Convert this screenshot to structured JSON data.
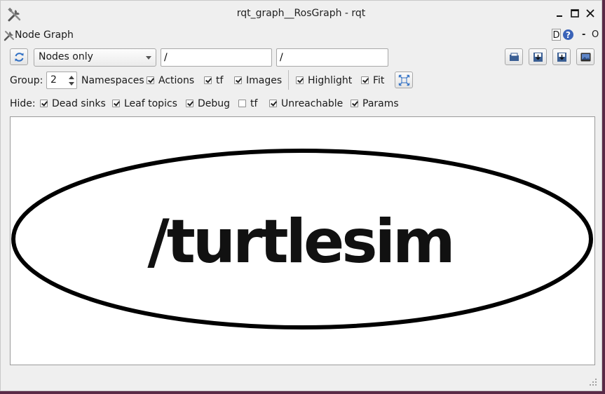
{
  "window": {
    "title": "rqt_graph__RosGraph - rqt",
    "minimize_icon": "minimize-icon",
    "maximize_icon": "maximize-icon",
    "close_icon": "close-icon"
  },
  "plugin": {
    "title": "Node Graph",
    "d_label": "D",
    "help_icon": "help-icon",
    "dash_label": "-",
    "o_label": "O"
  },
  "toolbar": {
    "refresh_icon": "refresh-icon",
    "graph_type": "Nodes only",
    "node_filter": "/",
    "topic_filter": "/",
    "right_icons": [
      "load-dot-icon",
      "save-dot-icon",
      "save-svg-icon",
      "save-image-icon"
    ]
  },
  "options": {
    "group_label": "Group:",
    "group_value": "2",
    "namespaces_label": "Namespaces",
    "checks": [
      {
        "label": "Actions",
        "checked": true
      },
      {
        "label": "tf",
        "checked": true
      },
      {
        "label": "Images",
        "checked": true
      },
      {
        "label": "Highlight",
        "checked": true
      },
      {
        "label": "Fit",
        "checked": true
      }
    ],
    "fit_icon": "fit-view-icon"
  },
  "hide": {
    "label": "Hide:",
    "items": [
      {
        "label": "Dead sinks",
        "checked": true
      },
      {
        "label": "Leaf topics",
        "checked": true
      },
      {
        "label": "Debug",
        "checked": true
      },
      {
        "label": "tf",
        "checked": false
      },
      {
        "label": "Unreachable",
        "checked": true
      },
      {
        "label": "Params",
        "checked": true
      }
    ]
  },
  "graph": {
    "nodes": [
      {
        "label": "/turtlesim"
      }
    ]
  },
  "colors": {
    "background": "#efefef",
    "canvas": "#ffffff",
    "node_stroke": "#000000"
  }
}
